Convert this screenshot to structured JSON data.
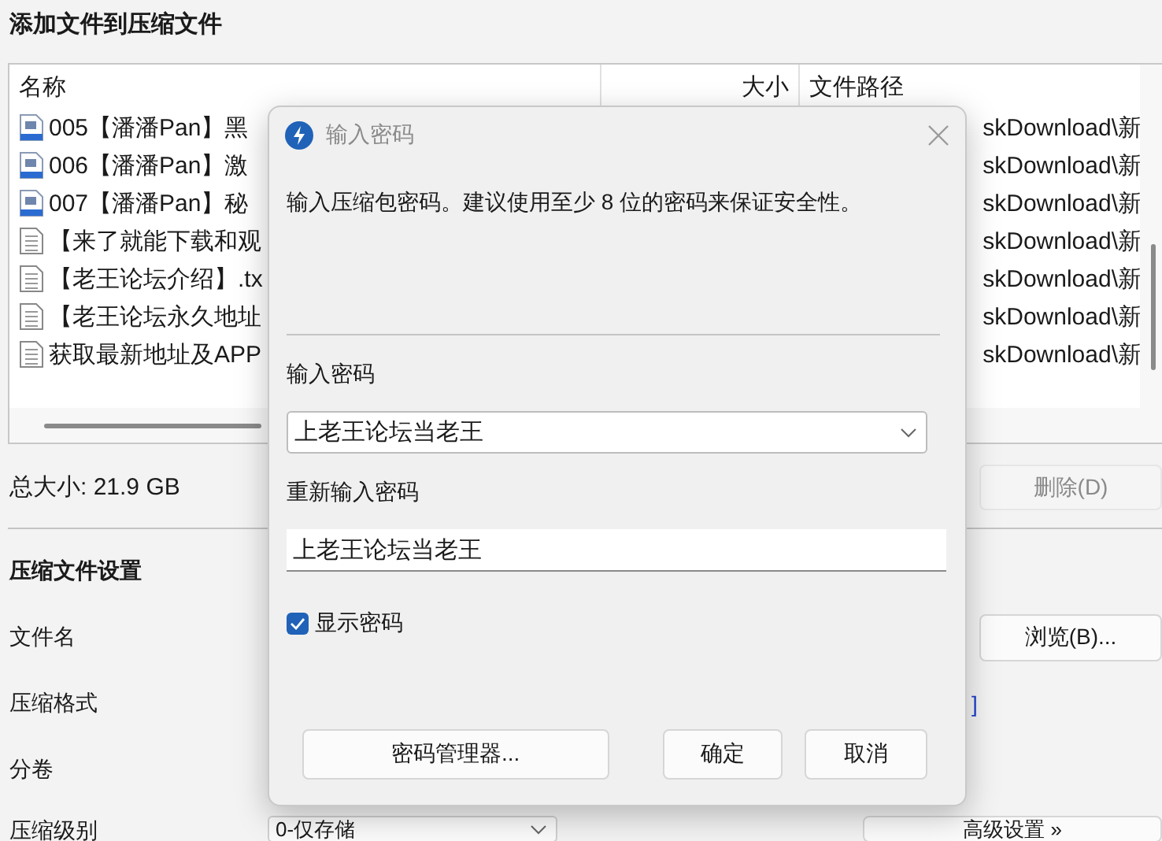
{
  "window": {
    "title": "添加文件到压缩文件"
  },
  "file_list": {
    "columns": [
      "名称",
      "大小",
      "文件路径"
    ],
    "rows": [
      {
        "name": "005【潘潘Pan】黑",
        "kind": "video",
        "path": "skDownload\\新"
      },
      {
        "name": "006【潘潘Pan】激",
        "kind": "video",
        "path": "skDownload\\新"
      },
      {
        "name": "007【潘潘Pan】秘",
        "kind": "video",
        "path": "skDownload\\新"
      },
      {
        "name": "【来了就能下载和观",
        "kind": "text",
        "path": "skDownload\\新"
      },
      {
        "name": "【老王论坛介绍】.tx",
        "kind": "text",
        "path": "skDownload\\新"
      },
      {
        "name": "【老王论坛永久地址",
        "kind": "text",
        "path": "skDownload\\新"
      },
      {
        "name": "获取最新地址及APP",
        "kind": "text",
        "path": "skDownload\\新"
      }
    ]
  },
  "total_size": "总大小: 21.9 GB",
  "delete_button": {
    "label": "删除(D)",
    "disabled": true
  },
  "settings": {
    "heading": "压缩文件设置",
    "fields": [
      {
        "label": "文件名",
        "button": "浏览(B)..."
      },
      {
        "label": "压缩格式",
        "link": "]"
      },
      {
        "label": "分卷"
      },
      {
        "label": "压缩级别",
        "value": "0-仅存储",
        "button": "高级设置 »"
      }
    ]
  },
  "dialog": {
    "title": "输入密码",
    "description": "输入压缩包密码。建议使用至少 8 位的密码来保证安全性。",
    "password_label": "输入密码",
    "password_value": "上老王论坛当老王",
    "confirm_label": "重新输入密码",
    "confirm_value": "上老王论坛当老王",
    "show_password": {
      "label": "显示密码",
      "checked": true
    },
    "buttons": [
      {
        "label": "密码管理器..."
      },
      {
        "label": "确定"
      },
      {
        "label": "取消"
      }
    ]
  }
}
